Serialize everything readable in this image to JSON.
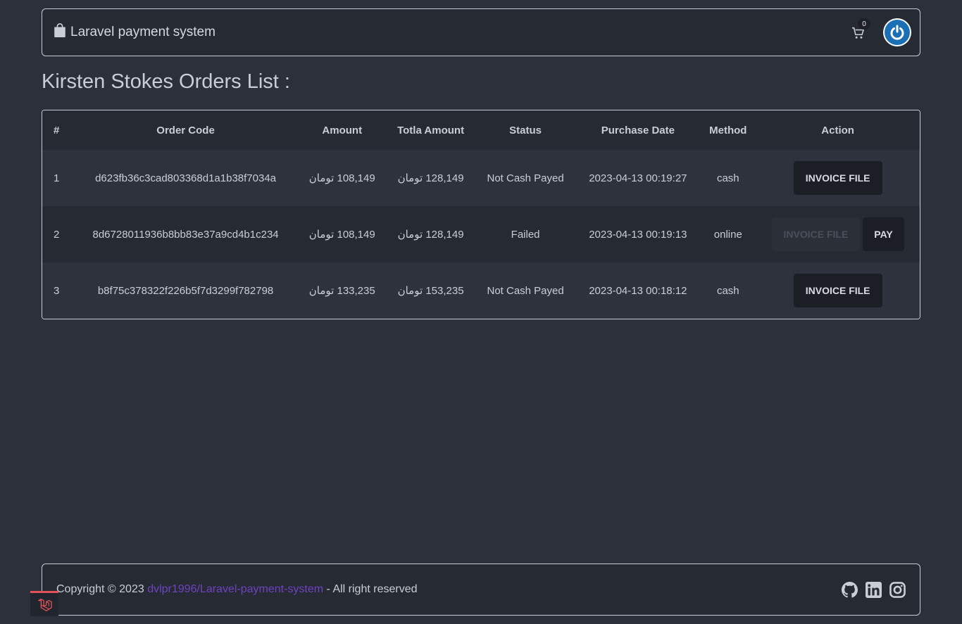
{
  "navbar": {
    "brand_label": "Laravel payment system",
    "cart_count": "0"
  },
  "page": {
    "title": "Kirsten Stokes Orders List :"
  },
  "table": {
    "headers": [
      "#",
      "Order Code",
      "Amount",
      "Totla Amount",
      "Status",
      "Purchase Date",
      "Method",
      "Action"
    ],
    "rows": [
      {
        "index": "1",
        "order_code": "d623fb36c3cad803368d1a1b38f7034a",
        "amount": "108,149 تومان",
        "total_amount": "128,149 تومان",
        "status": "Not Cash Payed",
        "purchase_date": "2023-04-13 00:19:27",
        "method": "cash",
        "invoice_label": "INVOICE FILE"
      },
      {
        "index": "2",
        "order_code": "8d6728011936b8bb83e37a9cd4b1c234",
        "amount": "108,149 تومان",
        "total_amount": "128,149 تومان",
        "status": "Failed",
        "purchase_date": "2023-04-13 00:19:13",
        "method": "online",
        "invoice_label": "INVOICE FILE",
        "pay_label": "PAY"
      },
      {
        "index": "3",
        "order_code": "b8f75c378322f226b5f7d3299f782798",
        "amount": "133,235 تومان",
        "total_amount": "153,235 تومان",
        "status": "Not Cash Payed",
        "purchase_date": "2023-04-13 00:18:12",
        "method": "cash",
        "invoice_label": "INVOICE FILE"
      }
    ]
  },
  "footer": {
    "copyright_prefix": "Copyright © 2023",
    "repo_link": "dvlpr1996/Laravel-payment-system",
    "copyright_suffix": "- All right reserved",
    "social_icons": [
      "github-icon",
      "linkedin-icon",
      "instagram-icon"
    ]
  },
  "colors": {
    "background": "#2b303b",
    "panel": "#262a33",
    "link": "#6f42c1",
    "avatar_blue": "#1a6fb5",
    "laravel_red": "#e3525b"
  }
}
